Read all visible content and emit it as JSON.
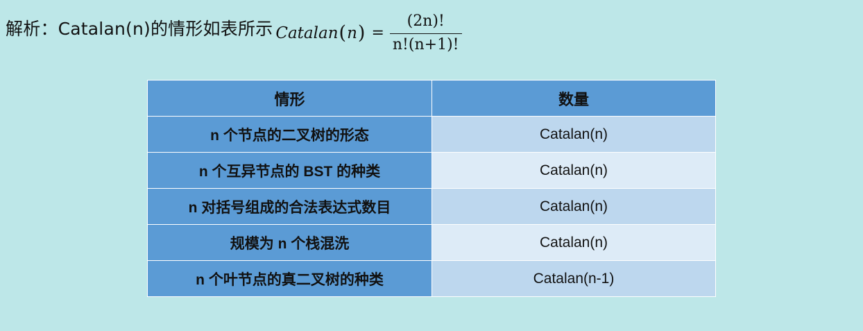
{
  "intro": {
    "text": "解析：Catalan(n)的情形如表所示",
    "formula": {
      "lhs_func": "Catalan",
      "lhs_arg": "n",
      "numerator": "(2n)!",
      "denominator": "n!(n+1)!"
    }
  },
  "table": {
    "headers": [
      "情形",
      "数量"
    ],
    "rows": [
      {
        "case": "n 个节点的二叉树的形态",
        "count": "Catalan(n)"
      },
      {
        "case": "n 个互异节点的 BST 的种类",
        "count": "Catalan(n)"
      },
      {
        "case": "n 对括号组成的合法表达式数目",
        "count": "Catalan(n)"
      },
      {
        "case": "规模为 n 个栈混洗",
        "count": "Catalan(n)"
      },
      {
        "case": "n 个叶节点的真二叉树的种类",
        "count": "Catalan(n-1)"
      }
    ]
  }
}
